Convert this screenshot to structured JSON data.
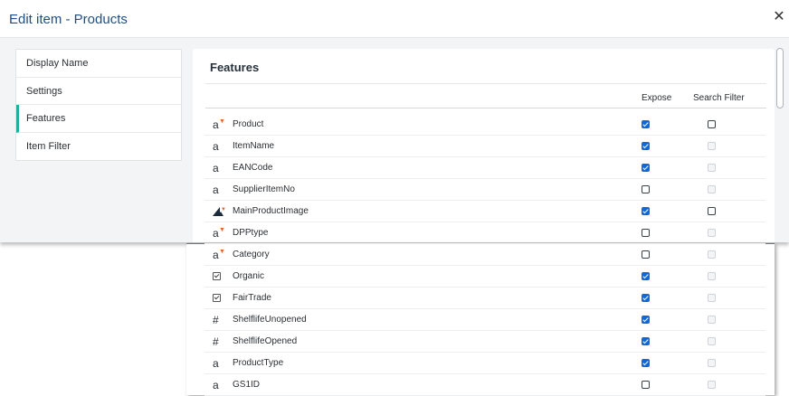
{
  "dialog": {
    "title": "Edit item - Products",
    "close_glyph": "✕"
  },
  "nav": {
    "items": [
      {
        "label": "Display Name",
        "active": false
      },
      {
        "label": "Settings",
        "active": false
      },
      {
        "label": "Features",
        "active": true
      },
      {
        "label": "Item Filter",
        "active": false
      }
    ]
  },
  "features": {
    "title": "Features",
    "columns": {
      "expose": "Expose",
      "search_filter": "Search Filter"
    },
    "rows": [
      {
        "name": "Product",
        "type": "text-list",
        "expose": true,
        "search_filter": "unchecked"
      },
      {
        "name": "ItemName",
        "type": "text",
        "expose": true,
        "search_filter": "disabled"
      },
      {
        "name": "EANCode",
        "type": "text",
        "expose": true,
        "search_filter": "disabled"
      },
      {
        "name": "SupplierItemNo",
        "type": "text",
        "expose": false,
        "search_filter": "disabled"
      },
      {
        "name": "MainProductImage",
        "type": "image",
        "expose": true,
        "search_filter": "unchecked"
      },
      {
        "name": "DPPtype",
        "type": "text-list",
        "expose": false,
        "search_filter": "disabled"
      },
      {
        "name": "Category",
        "type": "text-list",
        "expose": false,
        "search_filter": "disabled"
      },
      {
        "name": "Organic",
        "type": "boolean",
        "expose": true,
        "search_filter": "disabled"
      },
      {
        "name": "FairTrade",
        "type": "boolean",
        "expose": true,
        "search_filter": "disabled"
      },
      {
        "name": "ShelflifeUnopened",
        "type": "number",
        "expose": true,
        "search_filter": "disabled"
      },
      {
        "name": "ShelflifeOpened",
        "type": "number",
        "expose": true,
        "search_filter": "disabled"
      },
      {
        "name": "ProductType",
        "type": "text",
        "expose": true,
        "search_filter": "disabled"
      },
      {
        "name": "GS1ID",
        "type": "text",
        "expose": false,
        "search_filter": "disabled"
      }
    ]
  },
  "icons": {
    "text": "a",
    "text-list": "a",
    "number": "#",
    "boolean": "checkbox-icon",
    "image": "image-icon"
  },
  "colors": {
    "accent": "#1eaf9f",
    "checkbox_checked": "#1668c9",
    "title": "#1f4f82",
    "list_marker": "#e2672c"
  }
}
